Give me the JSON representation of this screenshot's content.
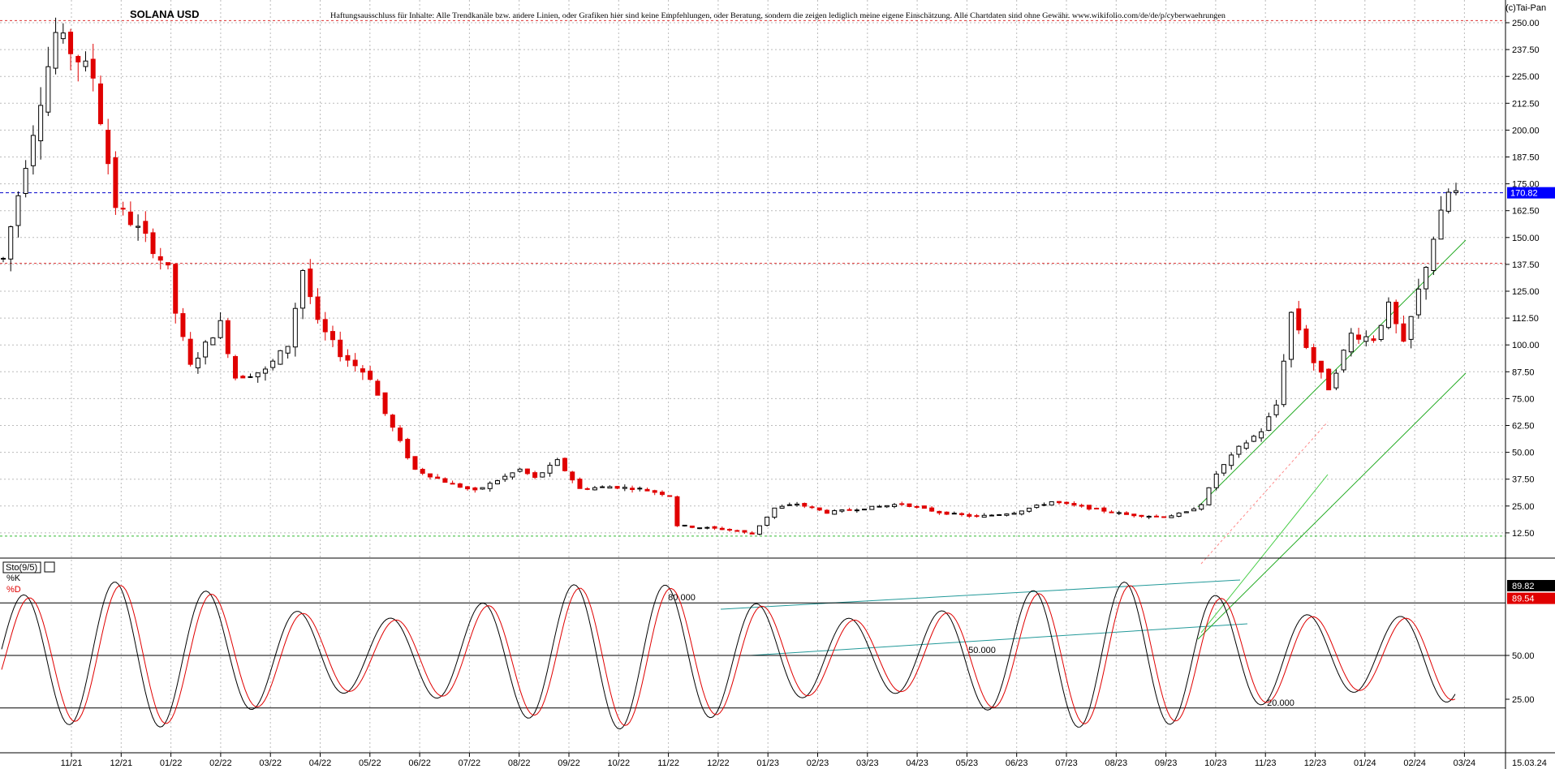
{
  "window": {
    "copyright": "(c)Tai-Pan"
  },
  "title": "SOLANA USD",
  "disclaimer": "Haftungsausschluss für Inhalte: Alle Trendkanäle bzw. andere Linien, oder Grafiken hier sind keine Empfehlungen, oder Beratung, sondern die zeigen lediglich meine eigene Einschätzung. Alle Chartdaten sind ohne Gewähr. www.wikifolio.com/de/de/p/cyberwaehrungen",
  "colors": {
    "up_candle": "#000000",
    "down_candle": "#e00000",
    "last_price_line": "#0000cc",
    "last_price_badge": "#0000ff",
    "channel_green": "#22aa22",
    "channel_teal": "#229999",
    "top_resistance": "#dd3333",
    "k_line": "#000000",
    "d_line": "#e00000"
  },
  "chart_data": [
    {
      "type": "candlestick",
      "title": "SOLANA USD",
      "y_ticks": [
        "250.00",
        "237.50",
        "225.00",
        "212.50",
        "200.00",
        "187.50",
        "175.00",
        "162.50",
        "150.00",
        "137.50",
        "125.00",
        "112.50",
        "100.00",
        "87.50",
        "75.00",
        "62.50",
        "50.00",
        "37.50",
        "25.00",
        "12.50"
      ],
      "ylim": [
        0,
        255
      ],
      "x_ticks": [
        "11/21",
        "12/21",
        "01/22",
        "02/22",
        "03/22",
        "04/22",
        "05/22",
        "06/22",
        "07/22",
        "08/22",
        "09/22",
        "10/22",
        "11/22",
        "12/22",
        "01/23",
        "02/23",
        "03/23",
        "04/23",
        "05/23",
        "06/23",
        "07/23",
        "08/23",
        "09/23",
        "10/23",
        "11/23",
        "12/23",
        "01/24",
        "02/24",
        "03/24"
      ],
      "date_label": "15.03.24",
      "last_price": 170.82,
      "last_price_label": "170.82",
      "horizontal_levels": [
        {
          "name": "top-resistance",
          "value": 251,
          "style": "dashed-red"
        },
        {
          "name": "mid-resistance",
          "value": 138,
          "style": "dashed-red"
        },
        {
          "name": "bottom-support",
          "value": 11,
          "style": "dashed-green"
        }
      ],
      "price_path": [
        [
          0,
          140
        ],
        [
          7,
          245
        ],
        [
          12,
          225
        ],
        [
          15,
          165
        ],
        [
          19,
          150
        ],
        [
          22,
          135
        ],
        [
          23,
          115
        ],
        [
          25,
          90
        ],
        [
          29,
          110
        ],
        [
          31,
          85
        ],
        [
          35,
          88
        ],
        [
          38,
          100
        ],
        [
          40,
          135
        ],
        [
          42,
          110
        ],
        [
          45,
          96
        ],
        [
          49,
          85
        ],
        [
          51,
          68
        ],
        [
          54,
          48
        ],
        [
          55,
          42
        ],
        [
          60,
          35
        ],
        [
          63,
          32
        ],
        [
          69,
          42
        ],
        [
          71,
          38
        ],
        [
          74,
          46
        ],
        [
          77,
          33
        ],
        [
          81,
          34
        ],
        [
          85,
          33
        ],
        [
          89,
          30
        ],
        [
          90,
          16
        ],
        [
          93,
          15
        ],
        [
          97,
          14
        ],
        [
          100,
          12
        ],
        [
          103,
          24
        ],
        [
          106,
          26
        ],
        [
          110,
          22
        ],
        [
          115,
          24
        ],
        [
          120,
          26
        ],
        [
          125,
          22
        ],
        [
          130,
          20
        ],
        [
          135,
          22
        ],
        [
          140,
          27
        ],
        [
          145,
          24
        ],
        [
          150,
          21
        ],
        [
          155,
          20
        ],
        [
          158,
          22
        ],
        [
          160,
          26
        ],
        [
          162,
          40
        ],
        [
          165,
          52
        ],
        [
          168,
          60
        ],
        [
          170,
          72
        ],
        [
          172,
          115
        ],
        [
          175,
          92
        ],
        [
          177,
          80
        ],
        [
          180,
          105
        ],
        [
          183,
          103
        ],
        [
          185,
          118
        ],
        [
          187,
          100
        ],
        [
          189,
          125
        ],
        [
          191,
          150
        ],
        [
          193,
          170.82
        ]
      ]
    },
    {
      "type": "line",
      "title": "Sto(9/5)",
      "legend": [
        "%K",
        "%D"
      ],
      "ylim": [
        0,
        100
      ],
      "y_ticks": [
        "50.00",
        "25.00"
      ],
      "levels_labels": [
        "80.000",
        "50.000",
        "20.000"
      ],
      "last_k": 89.82,
      "last_k_label": "89.82",
      "last_d": 89.54,
      "last_d_label": "89.54"
    }
  ]
}
